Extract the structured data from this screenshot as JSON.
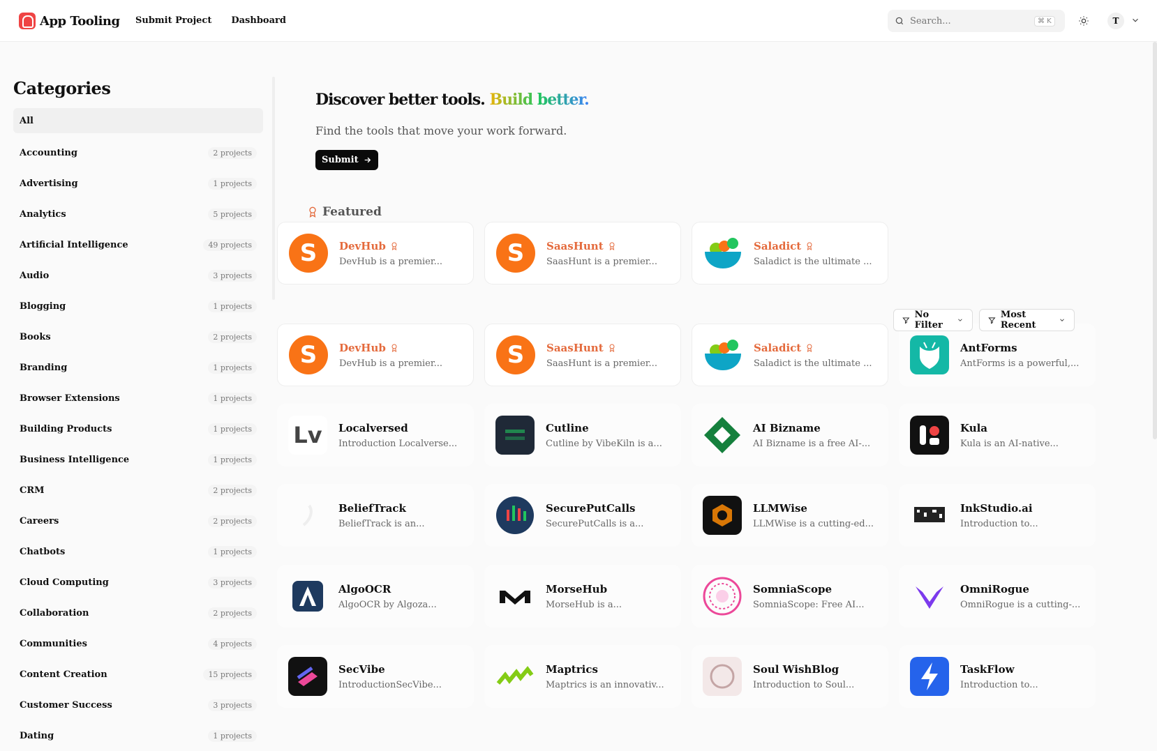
{
  "header": {
    "app_name": "App Tooling",
    "nav": [
      "Submit Project",
      "Dashboard"
    ],
    "search_placeholder": "Search...",
    "search_shortcut": "⌘ K",
    "avatar_initial": "T"
  },
  "sidebar": {
    "title": "Categories",
    "all_label": "All",
    "items": [
      {
        "label": "Accounting",
        "count": "2 projects"
      },
      {
        "label": "Advertising",
        "count": "1 projects"
      },
      {
        "label": "Analytics",
        "count": "5 projects"
      },
      {
        "label": "Artificial Intelligence",
        "count": "49 projects"
      },
      {
        "label": "Audio",
        "count": "3 projects"
      },
      {
        "label": "Blogging",
        "count": "1 projects"
      },
      {
        "label": "Books",
        "count": "2 projects"
      },
      {
        "label": "Branding",
        "count": "1 projects"
      },
      {
        "label": "Browser Extensions",
        "count": "1 projects"
      },
      {
        "label": "Building Products",
        "count": "1 projects"
      },
      {
        "label": "Business Intelligence",
        "count": "1 projects"
      },
      {
        "label": "CRM",
        "count": "2 projects"
      },
      {
        "label": "Careers",
        "count": "2 projects"
      },
      {
        "label": "Chatbots",
        "count": "1 projects"
      },
      {
        "label": "Cloud Computing",
        "count": "3 projects"
      },
      {
        "label": "Collaboration",
        "count": "2 projects"
      },
      {
        "label": "Communities",
        "count": "4 projects"
      },
      {
        "label": "Content Creation",
        "count": "15 projects"
      },
      {
        "label": "Customer Success",
        "count": "3 projects"
      },
      {
        "label": "Dating",
        "count": "1 projects"
      }
    ]
  },
  "hero": {
    "title_main": "Discover better tools.",
    "title_accent": "Build better.",
    "subtitle": "Find the tools that move your work forward.",
    "submit_label": "Submit"
  },
  "featured": {
    "heading": "Featured",
    "cards": [
      {
        "name": "DevHub",
        "desc": "DevHub is a premier...",
        "icon": "devhub-logo"
      },
      {
        "name": "SaasHunt",
        "desc": "SaasHunt is a premier...",
        "icon": "saashunt-logo"
      },
      {
        "name": "Saladict",
        "desc": "Saladict is the ultimate ...",
        "icon": "saladict-logo"
      }
    ]
  },
  "filters": {
    "filter_label": "No Filter",
    "sort_label": "Most Recent"
  },
  "projects": [
    {
      "name": "DevHub",
      "desc": "DevHub is a premier...",
      "featured": true,
      "icon": "devhub-logo"
    },
    {
      "name": "SaasHunt",
      "desc": "SaasHunt is a premier...",
      "featured": true,
      "icon": "saashunt-logo"
    },
    {
      "name": "Saladict",
      "desc": "Saladict is the ultimate ...",
      "featured": true,
      "icon": "saladict-logo"
    },
    {
      "name": "AntForms",
      "desc": "AntForms is a powerful,...",
      "featured": false,
      "icon": "antforms-logo"
    },
    {
      "name": "Localversed",
      "desc": "Introduction Localverse...",
      "featured": false,
      "icon": "localversed-logo"
    },
    {
      "name": "Cutline",
      "desc": "Cutline by VibeKiln is a...",
      "featured": false,
      "icon": "cutline-logo"
    },
    {
      "name": "AI Bizname",
      "desc": "AI Bizname is a free AI-...",
      "featured": false,
      "icon": "aibizname-logo"
    },
    {
      "name": "Kula",
      "desc": "Kula is an AI-native...",
      "featured": false,
      "icon": "kula-logo"
    },
    {
      "name": "BeliefTrack",
      "desc": "BeliefTrack is an...",
      "featured": false,
      "icon": "belieftrack-logo"
    },
    {
      "name": "SecurePutCalls",
      "desc": "SecurePutCalls is a...",
      "featured": false,
      "icon": "secureputcalls-logo"
    },
    {
      "name": "LLMWise",
      "desc": "LLMWise is a cutting-ed...",
      "featured": false,
      "icon": "llmwise-logo"
    },
    {
      "name": "InkStudio.ai",
      "desc": "Introduction to...",
      "featured": false,
      "icon": "inkstudio-logo"
    },
    {
      "name": "AlgoOCR",
      "desc": "AlgoOCR by Algoza...",
      "featured": false,
      "icon": "algoocr-logo"
    },
    {
      "name": "MorseHub",
      "desc": "MorseHub is a...",
      "featured": false,
      "icon": "morsehub-logo"
    },
    {
      "name": "SomniaScope",
      "desc": "SomniaScope: Free AI...",
      "featured": false,
      "icon": "somniascope-logo"
    },
    {
      "name": "OmniRogue",
      "desc": "OmniRogue is a cutting-...",
      "featured": false,
      "icon": "omnirogue-logo"
    },
    {
      "name": "SecVibe",
      "desc": "IntroductionSecVibe...",
      "featured": false,
      "icon": "secvibe-logo"
    },
    {
      "name": "Maptrics",
      "desc": "Maptrics is an innovativ...",
      "featured": false,
      "icon": "maptrics-logo"
    },
    {
      "name": "Soul WishBlog",
      "desc": "Introduction to Soul...",
      "featured": false,
      "icon": "soulwishblog-logo"
    },
    {
      "name": "TaskFlow",
      "desc": "Introduction to...",
      "featured": false,
      "icon": "taskflow-logo"
    }
  ]
}
